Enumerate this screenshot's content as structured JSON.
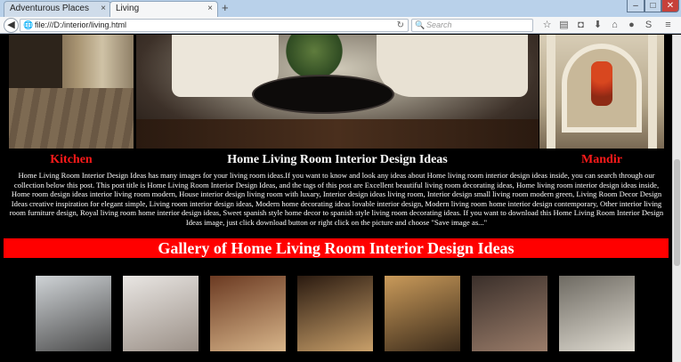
{
  "browser": {
    "tabs": [
      {
        "label": "Adventurous Places",
        "close": "×"
      },
      {
        "label": "Living",
        "close": "×"
      }
    ],
    "new_tab": "+",
    "url": "file:///D:/interior/living.html",
    "search_placeholder": "Search",
    "window_controls": {
      "minimize": "–",
      "maximize": "□",
      "close": "✕"
    }
  },
  "page": {
    "side_left_label": "Kitchen",
    "main_title": "Home Living Room Interior Design Ideas",
    "side_right_label": "Mandir",
    "description": "Home Living Room Interior Design Ideas has many images for your living room ideas.If you want to know and look any ideas about Home living room interior design ideas inside, you can search through our collection below this post. This post title is Home Living Room Interior Design Ideas, and the tags of this post are Excellent beautiful living room decorating ideas, Home living room interior design ideas inside, Home room design ideas interior living room modern, House interior design living room with luxary, Interior design ideas living room, Interior design small living room modern green, Living Room Decor Design Ideas creative inspiration for elegant simple, Living room interior design ideas, Modern home decorating ideas lovable interior design, Modern living room home interior design contemporary, Other interior living room furniture design, Royal living room home interior design ideas, Sweet spanish style home decor to spanish style living room decorating ideas. If you want to download this Home Living Room Interior Design Ideas image, just click download button or right click on the picture and choose \"Save image as...\"",
    "gallery_title": "Gallery of Home Living Room Interior Design Ideas",
    "gallery": [
      {
        "name": "gallery-image-1",
        "colors": [
          "#cfd3d6",
          "#4a4a4a"
        ]
      },
      {
        "name": "gallery-image-2",
        "colors": [
          "#e9e6e3",
          "#9a8f86"
        ]
      },
      {
        "name": "gallery-image-3",
        "colors": [
          "#6b3a22",
          "#d8b58a"
        ]
      },
      {
        "name": "gallery-image-4",
        "colors": [
          "#2a1a10",
          "#c9a06a"
        ]
      },
      {
        "name": "gallery-image-5",
        "colors": [
          "#c99a5a",
          "#3a2a1a"
        ]
      },
      {
        "name": "gallery-image-6",
        "colors": [
          "#3a2f2a",
          "#9b7d6a"
        ]
      },
      {
        "name": "gallery-image-7",
        "colors": [
          "#6e6a62",
          "#e0dcd2"
        ]
      }
    ],
    "accent_red": "#ff0000"
  }
}
